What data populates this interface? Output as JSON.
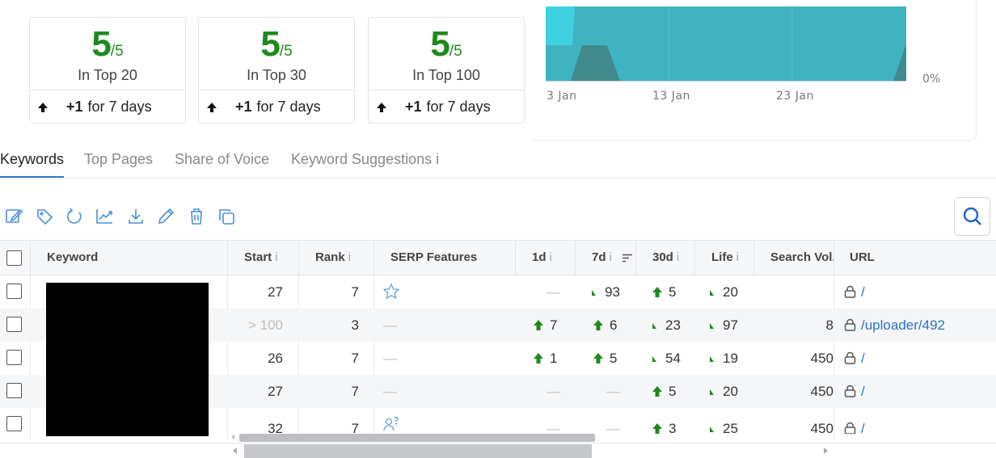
{
  "cards": [
    {
      "value": "5",
      "denom": "/5",
      "label": "In Top 20",
      "change": "+1",
      "period": "for 7 days"
    },
    {
      "value": "5",
      "denom": "/5",
      "label": "In Top 30",
      "change": "+1",
      "period": "for 7 days"
    },
    {
      "value": "5",
      "denom": "/5",
      "label": "In Top 100",
      "change": "+1",
      "period": "for 7 days"
    }
  ],
  "chart": {
    "x_ticks": [
      "3 Jan",
      "13 Jan",
      "23 Jan"
    ],
    "y_label_right": "0%",
    "colors": {
      "fill_main": "#40b3c0",
      "fill_light": "#3fd0e0",
      "fill_dark": "#3f8a8c"
    }
  },
  "tabs": [
    {
      "label": "Keywords",
      "active": true
    },
    {
      "label": "Top Pages",
      "active": false
    },
    {
      "label": "Share of Voice",
      "active": false
    },
    {
      "label": "Keyword Suggestions i",
      "active": false
    }
  ],
  "toolbar_icons": [
    "edit-icon",
    "tag-icon",
    "refresh-icon",
    "chart-icon",
    "download-icon",
    "pencil-icon",
    "trash-icon",
    "copy-icon"
  ],
  "table": {
    "headers": {
      "keyword": "Keyword",
      "start": "Start",
      "rank": "Rank",
      "serp": "SERP Features",
      "d1": "1d",
      "d7": "7d",
      "d30": "30d",
      "life": "Life",
      "search_vol": "Search Vol.",
      "url": "URL",
      "info": "i"
    },
    "rows": [
      {
        "start": "27",
        "rank": "7",
        "serp": "star",
        "d1": "—",
        "d7": "93",
        "d7_icon": "tiny",
        "d30": "5",
        "d30_icon": "up",
        "life": "20",
        "life_icon": "tiny",
        "vol": "",
        "url": "/"
      },
      {
        "start": "> 100",
        "rank": "3",
        "serp": "—",
        "d1": "7",
        "d1_icon": "up",
        "d7": "6",
        "d7_icon": "up",
        "d30": "23",
        "d30_icon": "tiny",
        "life": "97",
        "life_icon": "tiny",
        "vol": "8",
        "url": "/uploader/492"
      },
      {
        "start": "26",
        "rank": "7",
        "serp": "—",
        "d1": "1",
        "d1_icon": "up",
        "d7": "5",
        "d7_icon": "up",
        "d30": "54",
        "d30_icon": "tiny",
        "life": "19",
        "life_icon": "tiny",
        "vol": "450",
        "url": "/"
      },
      {
        "start": "27",
        "rank": "7",
        "serp": "—",
        "d1": "—",
        "d7": "—",
        "d30": "5",
        "d30_icon": "up",
        "life": "20",
        "life_icon": "tiny",
        "vol": "450",
        "url": "/"
      },
      {
        "start": "32",
        "rank": "7",
        "serp": "people",
        "d1": "—",
        "d7": "—",
        "d30": "3",
        "d30_icon": "up",
        "life": "25",
        "life_icon": "tiny",
        "vol": "450",
        "url": "/"
      }
    ]
  }
}
